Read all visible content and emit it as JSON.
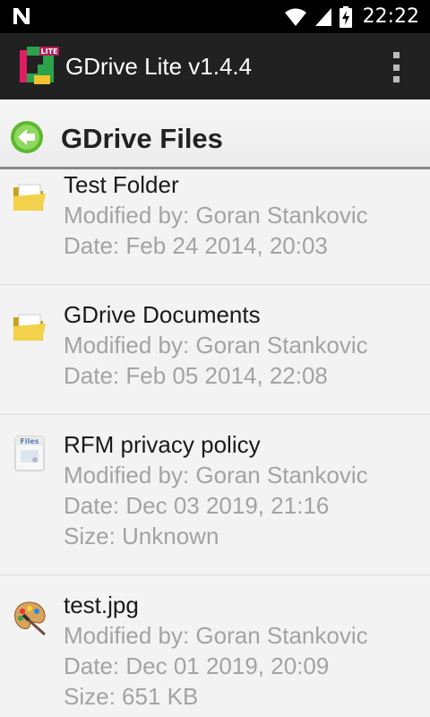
{
  "status_bar": {
    "time": "22:22",
    "icons": [
      "notification-n-icon",
      "wifi-icon",
      "signal-icon",
      "battery-charging-icon"
    ]
  },
  "app_bar": {
    "title": "GDrive Lite v1.4.4",
    "logo_badge": "LITE"
  },
  "header": {
    "title": "GDrive Files"
  },
  "files": [
    {
      "name": "Test Folder",
      "icon": "folder-icon",
      "meta": [
        "Modified by: Goran Stankovic",
        "Date: Feb 24 2014, 20:03"
      ]
    },
    {
      "name": "GDrive Documents",
      "icon": "folder-icon",
      "meta": [
        "Modified by: Goran Stankovic",
        "Date: Feb 05 2014, 22:08"
      ]
    },
    {
      "name": "RFM privacy policy",
      "icon": "document-icon",
      "icon_text": "Files",
      "meta": [
        "Modified by: Goran Stankovic",
        "Date: Dec 03 2019, 21:16",
        "Size: Unknown"
      ]
    },
    {
      "name": "test.jpg",
      "icon": "image-palette-icon",
      "meta": [
        "Modified by: Goran Stankovic",
        "Date: Dec 01 2019, 20:09",
        "Size: 651 KB"
      ]
    }
  ],
  "colors": {
    "status_bar": "#000000",
    "app_bar": "#212121",
    "background": "#f3f3f3",
    "meta_text": "#a3a3a3",
    "back_button": "#5cb82e"
  }
}
